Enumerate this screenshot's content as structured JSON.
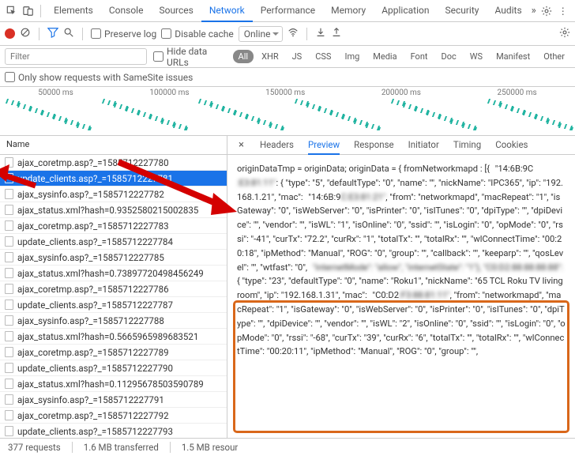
{
  "topTabs": [
    "Elements",
    "Console",
    "Sources",
    "Network",
    "Performance",
    "Memory",
    "Application",
    "Security",
    "Audits"
  ],
  "activeTopTab": 3,
  "controls": {
    "preserveLog": "Preserve log",
    "disableCache": "Disable cache",
    "throttling": "Online"
  },
  "filter": {
    "placeholder": "Filter",
    "hideDataUrls": "Hide data URLs",
    "types": [
      "All",
      "XHR",
      "JS",
      "CSS",
      "Img",
      "Media",
      "Font",
      "Doc",
      "WS",
      "Manifest",
      "Other"
    ],
    "activeType": 0,
    "sameSite": "Only show requests with SameSite issues"
  },
  "timeline": {
    "labels": [
      "50000 ms",
      "100000 ms",
      "150000 ms",
      "200000 ms",
      "250000 ms"
    ]
  },
  "leftHeader": "Name",
  "requests": [
    "ajax_coretmp.asp?_=1585712227780",
    "update_clients.asp?_=1585712227781",
    "ajax_sysinfo.asp?_=1585712227782",
    "ajax_status.xml?hash=0.9352580215002835",
    "ajax_coretmp.asp?_=1585712227783",
    "update_clients.asp?_=1585712227784",
    "ajax_sysinfo.asp?_=1585712227785",
    "ajax_status.xml?hash=0.73897720498456249",
    "ajax_coretmp.asp?_=1585712227786",
    "update_clients.asp?_=1585712227787",
    "ajax_sysinfo.asp?_=1585712227788",
    "ajax_status.xml?hash=0.5665965989683521",
    "ajax_coretmp.asp?_=1585712227789",
    "update_clients.asp?_=1585712227790",
    "ajax_status.xml?hash=0.11295678503590789",
    "ajax_sysinfo.asp?_=1585712227791",
    "ajax_coretmp.asp?_=1585712227792",
    "update_clients.asp?_=1585712227793"
  ],
  "selectedRequest": 1,
  "rightTabs": [
    "Headers",
    "Preview",
    "Response",
    "Initiator",
    "Timing",
    "Cookies"
  ],
  "activeRightTab": 1,
  "preview": {
    "lead": "originDataTmp = originData; originData = { fromNetworkmapd : [{",
    "dev1_mac": "\"14:6B:9C",
    "dev1_mac_blur": ":E3:81:11\"",
    "dev1_a": ": { \"type\": \"5\", \"defaultType\": \"0\", \"name\": \"\", \"nickName\": \"IPC365\", \"ip\": \"192.168.1.21\", \"mac\":",
    "dev1_mac2": "\"14:6B:9",
    "dev1_mac2_blur": "C:E3:81:21\"",
    "dev1_b": ", \"from\": \"networkmapd\", \"macRepeat\": \"1\", \"isGateway\": \"0\", \"isWebServer\": \"0\", \"isPrinter\": \"0\", \"isITunes\": \"0\", \"dpiType\": \"\", \"dpiDevice\": \"\", \"vendor\": \"\", \"isWL\": \"1\", \"isOnline\": \"0\", \"ssid\": \"\", \"isLogin\": \"0\", \"opMode\": \"0\", \"rssi\": \"-41\", \"curTx\": \"72.2\", \"curRx\": \"1\", \"totalTx\": \"\", \"totalRx\": \"\", \"wlConnectTime\": \"00:20:18\", \"ipMethod\": \"Manual\", \"ROG\": \"0\", \"group\": \"\", \"callback\": \"\", \"keeparp\": \"\", \"qosLevel\": \"\", \"wtfast\": \"0\",",
    "dev1_tail_blur": "\"internetMode\": \"allow\", \"internetState\": \"1\"}, \"C0:D2:88:88:88:88\":",
    "dev2_a": "{ \"type\": \"23\", \"defaultType\": \"0\", \"name\": \"Roku1\", \"nickName\": \"65 TCL Roku TV living room\", \"ip\": \"192.168.1.31\", \"mac\":",
    "dev2_mac": "\"C0:D2",
    "dev2_mac_blur": ":F3:88:81:11\"",
    "dev2_b": ", \"from\": \"networkmapd\", \"macRepeat\": \"1\", \"isGateway\": \"0\", \"isWebServer\": \"0\", \"isPrinter\": \"0\", \"isITunes\": \"0\", \"dpiType\": \"\", \"dpiDevice\": \"\", \"vendor\": \"\", \"isWL\": \"2\", \"isOnline\": \"0\", \"ssid\": \"\", \"isLogin\": \"0\", \"opMode\": \"0\", \"rssi\": \"-68\", \"curTx\": \"39\", \"curRx\": \"6\", \"totalTx\": \"\", \"totalRx\": \"\", \"wlConnectTime\": \"00:20:11\", \"ipMethod\": \"Manual\", \"ROG\": \"0\", \"group\": \"\","
  },
  "status": {
    "requests": "377 requests",
    "transferred": "1.6 MB transferred",
    "resources": "1.5 MB resour"
  }
}
